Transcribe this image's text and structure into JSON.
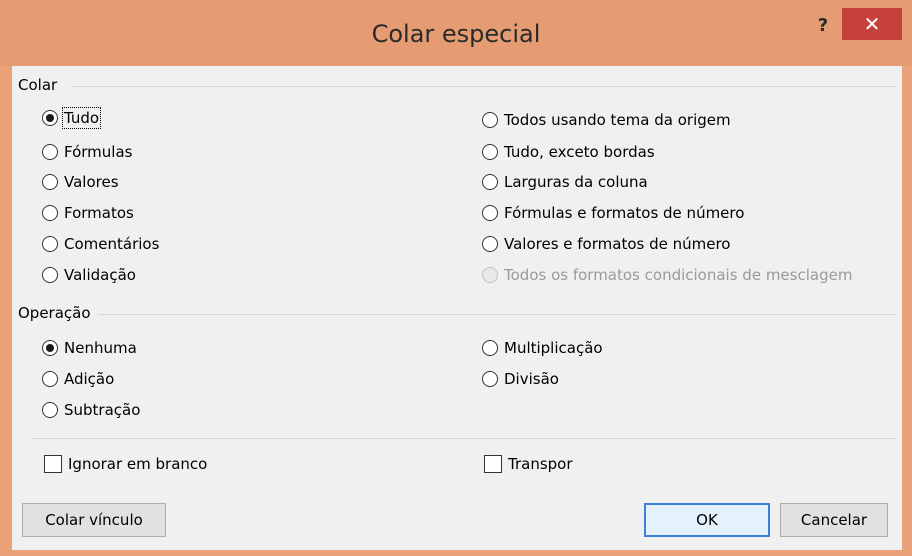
{
  "window": {
    "title": "Colar especial",
    "help_label": "?",
    "close_label": "✕"
  },
  "colar": {
    "label": "Colar",
    "left_options": [
      "Tudo",
      "Fórmulas",
      "Valores",
      "Formatos",
      "Comentários",
      "Validação"
    ],
    "right_options": [
      "Todos usando tema da origem",
      "Tudo, exceto bordas",
      "Larguras da coluna",
      "Fórmulas e formatos de número",
      "Valores e formatos de número",
      "Todos os formatos condicionais de mesclagem"
    ],
    "selected": "Tudo",
    "disabled": [
      "Todos os formatos condicionais de mesclagem"
    ]
  },
  "operacao": {
    "label": "Operação",
    "left_options": [
      "Nenhuma",
      "Adição",
      "Subtração"
    ],
    "right_options": [
      "Multiplicação",
      "Divisão"
    ],
    "selected": "Nenhuma"
  },
  "checkboxes": {
    "skip_blanks": "Ignorar em branco",
    "transpose": "Transpor"
  },
  "buttons": {
    "paste_link": "Colar vínculo",
    "ok": "OK",
    "cancel": "Cancelar"
  },
  "colors": {
    "titlebar": "#e69c72",
    "close": "#c7413c",
    "accent": "#3c7fd6"
  }
}
